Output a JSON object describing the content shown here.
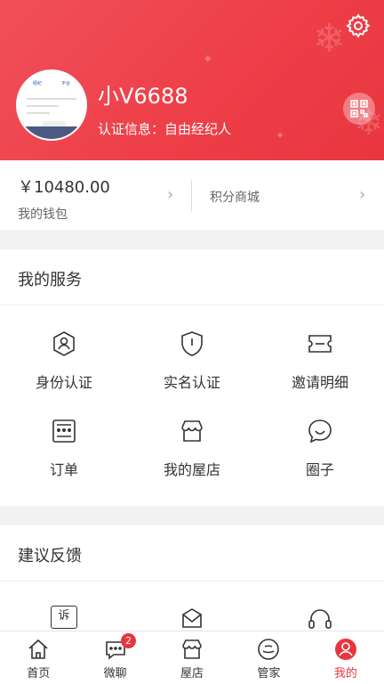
{
  "profile": {
    "username": "小V6688",
    "certification": "认证信息：自由经纪人"
  },
  "wallet": {
    "balance": "￥10480.00",
    "label": "我的钱包",
    "mall_label": "积分商城"
  },
  "services": {
    "title": "我的服务",
    "items": [
      {
        "label": "身份认证",
        "icon": "user-id-icon"
      },
      {
        "label": "实名认证",
        "icon": "shield-icon"
      },
      {
        "label": "邀请明细",
        "icon": "ticket-icon"
      },
      {
        "label": "订单",
        "icon": "order-icon"
      },
      {
        "label": "我的屋店",
        "icon": "store-icon"
      },
      {
        "label": "圈子",
        "icon": "chat-bubble-icon"
      }
    ]
  },
  "feedback": {
    "title": "建议反馈",
    "icon_text": "诉"
  },
  "tabbar": {
    "items": [
      {
        "label": "首页",
        "icon": "home-icon"
      },
      {
        "label": "微聊",
        "icon": "chat-icon",
        "badge": "2"
      },
      {
        "label": "屋店",
        "icon": "store-icon"
      },
      {
        "label": "管家",
        "icon": "butler-icon"
      },
      {
        "label": "我的",
        "icon": "profile-icon",
        "active": true
      }
    ]
  },
  "colors": {
    "accent": "#e8363f",
    "header_gradient_start": "#f0505a"
  }
}
